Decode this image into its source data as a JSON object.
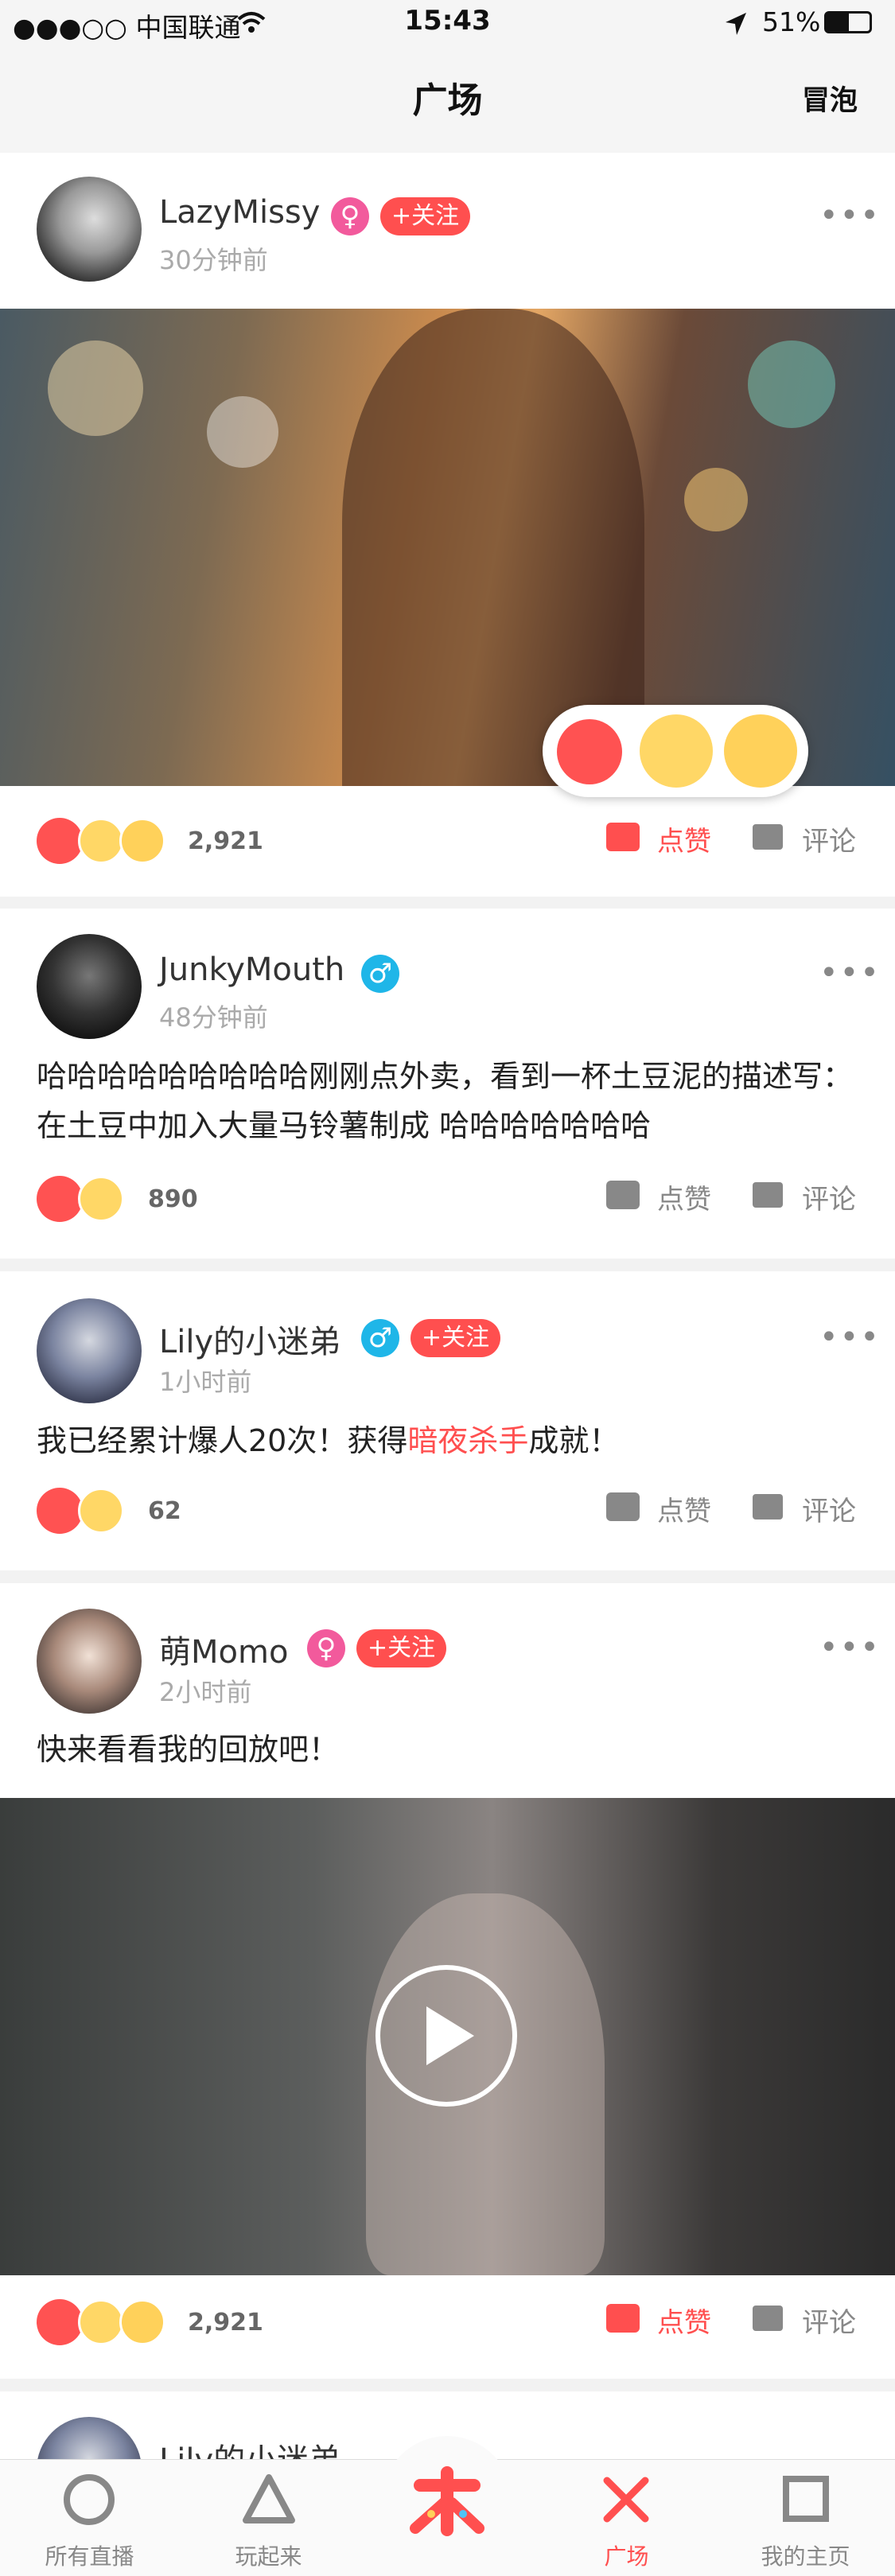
{
  "status_bar": {
    "carrier": "●●●○○ 中国联通",
    "time": "15:43",
    "battery": "51%"
  },
  "nav": {
    "title": "广场",
    "right": "冒泡"
  },
  "posts": [
    {
      "user": "LazyMissy",
      "gender": "♀",
      "follow": "+关注",
      "time": "30分钟前",
      "count": "2,921",
      "like": "点赞",
      "comment": "评论",
      "more": "•••"
    },
    {
      "user": "JunkyMouth",
      "gender": "♂",
      "time": "48分钟前",
      "text": "哈哈哈哈哈哈哈哈哈刚刚点外卖，看到一杯土豆泥的描述写：在土豆中加入大量马铃薯制成 哈哈哈哈哈哈哈",
      "count": "890",
      "like": "点赞",
      "comment": "评论",
      "more": "•••"
    },
    {
      "user": "Lily的小迷弟",
      "gender": "♂",
      "follow": "+关注",
      "time": "1小时前",
      "text_before": "我已经累计爆人20次！获得",
      "text_highlight": "暗夜杀手",
      "text_after": "成就！",
      "count": "62",
      "like": "点赞",
      "comment": "评论",
      "more": "•••"
    },
    {
      "user": "萌Momo",
      "gender": "♀",
      "follow": "+关注",
      "time": "2小时前",
      "text": "快来看看我的回放吧！",
      "count": "2,921",
      "like": "点赞",
      "comment": "评论",
      "more": "•••"
    }
  ],
  "peek_user": "Lily的小迷弟",
  "tabs": [
    {
      "label": "所有直播",
      "icon": "circle-icon"
    },
    {
      "label": "玩起来",
      "icon": "triangle-icon"
    },
    {
      "label": "",
      "icon": "lai-logo-icon"
    },
    {
      "label": "广场",
      "icon": "cross-icon"
    },
    {
      "label": "我的主页",
      "icon": "square-icon"
    }
  ],
  "colors": {
    "accent": "#ff4f4f",
    "male": "#1fb6e8",
    "female": "#f25a9c"
  }
}
